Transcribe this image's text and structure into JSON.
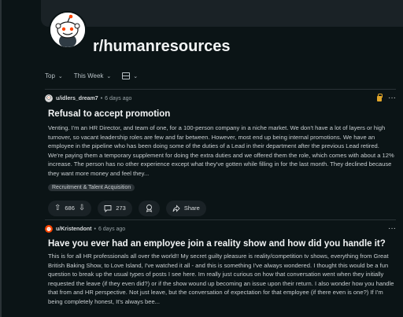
{
  "subreddit": {
    "name": "r/humanresources"
  },
  "sort": {
    "primary": "Top",
    "range": "This Week"
  },
  "posts": [
    {
      "user": "u/idlers_dream7",
      "time": "6 days ago",
      "title": "Refusal to accept promotion",
      "body": "Venting. I'm an HR Director, and team of one, for a 100-person company in a niche market. We don't have a lot of layers or high turnover, so vacant leadership roles are few and far between. However, most end up being internal promotions. We have an employee in the pipeline who has been doing some of the duties of a Lead in their department after the previous Lead retired. We're paying them a temporary supplement for doing the extra duties and we offered them the role, which comes with about a 12% increase. The person has no other experience except what they've gotten while filling in for the last month. They declined because they want more money and feel they...",
      "flair": "Recruitment & Talent Acquisition",
      "votes": "686",
      "comments": "273",
      "share_label": "Share"
    },
    {
      "user": "u/Kristendont",
      "time": "6 days ago",
      "title": "Have you ever had an employee join a reality show and how did you handle it?",
      "body": "This is for all HR professionals all over the world!! My secret guilty pleasure is reality/competition tv shows, everything from Great British Baking Show, to Love Island, I've watched it all - and this is something I've always wondered. I thought this would be a fun question to break up the usual types of posts I see here. Im really just curious on how that conversation went when they initially requested the leave (if they even did?) or if the show wound up becoming an issue upon their return. I also wonder how you handle that from and HR perspective. Not just leave, but the conversation of expectation for that employee (if there even is one?) If I'm being completely honest, It's always bee..."
    }
  ]
}
